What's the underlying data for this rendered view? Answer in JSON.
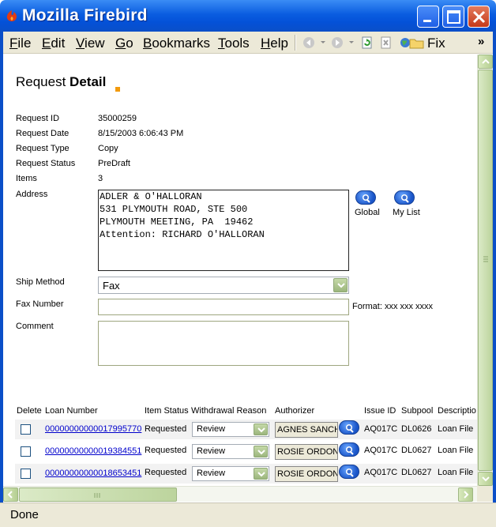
{
  "window": {
    "title": "Mozilla Firebird",
    "brand_color": "#0a5de0"
  },
  "menubar": {
    "items": [
      {
        "label": "File",
        "key": "F",
        "rest": "ile"
      },
      {
        "label": "Edit",
        "key": "E",
        "rest": "dit"
      },
      {
        "label": "View",
        "key": "V",
        "rest": "iew"
      },
      {
        "label": "Go",
        "key": "G",
        "rest": "o"
      },
      {
        "label": "Bookmarks",
        "key": "B",
        "rest": "ookmarks"
      },
      {
        "label": "Tools",
        "key": "T",
        "rest": "ools"
      },
      {
        "label": "Help",
        "key": "H",
        "rest": "elp"
      }
    ],
    "bookmark_label": "Fix",
    "overflow": "»"
  },
  "page": {
    "title_plain": "Request ",
    "title_bold": "Detail",
    "accent_color": "#f29a0d"
  },
  "fields": {
    "request_id": {
      "label": "Request ID",
      "value": "35000259"
    },
    "request_date": {
      "label": "Request Date",
      "value": "8/15/2003 6:06:43 PM"
    },
    "request_type": {
      "label": "Request Type",
      "value": "Copy"
    },
    "request_status": {
      "label": "Request Status",
      "value": "PreDraft"
    },
    "items": {
      "label": "Items",
      "value": "3"
    },
    "address": {
      "label": "Address",
      "value": "ADLER & O'HALLORAN\n531 PLYMOUTH ROAD, STE 500\nPLYMOUTH MEETING, PA  19462\nAttention: RICHARD O'HALLORAN"
    },
    "ship_method": {
      "label": "Ship Method",
      "value": "Fax"
    },
    "fax_number": {
      "label": "Fax Number",
      "value": "",
      "hint": "Format: xxx xxx xxxx"
    },
    "comment": {
      "label": "Comment",
      "value": ""
    }
  },
  "lookups": {
    "global": "Global",
    "my_list": "My List"
  },
  "table": {
    "headers": [
      "Delete",
      "Loan Number",
      "Item Status",
      "Withdrawal Reason",
      "Authorizer",
      "Issue ID",
      "Subpool",
      "Descriptio"
    ],
    "rows": [
      {
        "delete": false,
        "loan_number": "00000000000017995770",
        "item_status": "Requested",
        "reason": "Review",
        "authorizer": "AGNES SANCH",
        "issue_id": "AQ017C",
        "subpool": "DL0626",
        "description": "Loan File"
      },
      {
        "delete": false,
        "loan_number": "00000000000019384551",
        "item_status": "Requested",
        "reason": "Review",
        "authorizer": "ROSIE ORDONE",
        "issue_id": "AQ017C",
        "subpool": "DL0627",
        "description": "Loan File"
      },
      {
        "delete": false,
        "loan_number": "00000000000018653451",
        "item_status": "Requested",
        "reason": "Review",
        "authorizer": "ROSIE ORDONE",
        "issue_id": "AQ017C",
        "subpool": "DL0627",
        "description": "Loan File"
      }
    ]
  },
  "status_bar": {
    "text": "Done"
  }
}
